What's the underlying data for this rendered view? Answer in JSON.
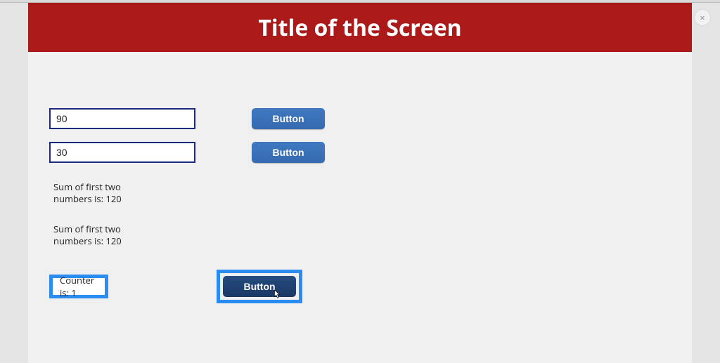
{
  "header": {
    "title": "Title of the Screen"
  },
  "close_icon": "×",
  "inputs": {
    "first": "90",
    "second": "30"
  },
  "buttons": {
    "row1": "Button",
    "row2": "Button",
    "bottom": "Button"
  },
  "sums": {
    "label1": "Sum of first two numbers is: 120",
    "label2": "Sum of first two numbers is: 120"
  },
  "counter": {
    "label": "Counter is: 1"
  }
}
